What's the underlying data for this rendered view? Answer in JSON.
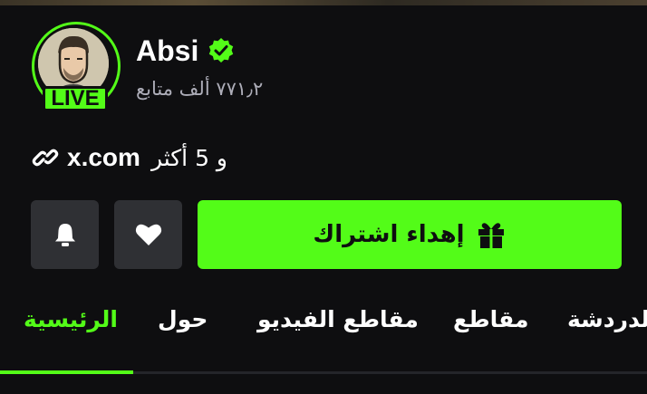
{
  "profile": {
    "name": "Absi",
    "live_badge": "LIVE",
    "followers": "٧٧١٫٢ ألف متابع"
  },
  "links": {
    "primary": "x.com",
    "more": "و 5 أكثر"
  },
  "actions": {
    "gift_label": "إهداء اشتراك"
  },
  "tabs": [
    {
      "label": "الرئيسية",
      "active": true
    },
    {
      "label": "حول"
    },
    {
      "label": "مقاطع الفيديو"
    },
    {
      "label": "مقاطع"
    },
    {
      "label": "الدردشة"
    }
  ],
  "colors": {
    "accent": "#53fc18",
    "background": "#0e0e10",
    "button_dark": "#2f3034",
    "muted_text": "#adadb8"
  },
  "icons": {
    "verified": "verified-badge-icon",
    "link": "link-icon",
    "bell": "bell-icon",
    "heart": "heart-icon",
    "gift": "gift-icon"
  }
}
